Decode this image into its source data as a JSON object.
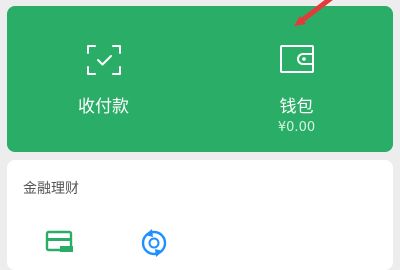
{
  "colors": {
    "card_green": "#2aae67",
    "annotation_red": "#e23b3b",
    "fin_green": "#2aae67",
    "fin_blue": "#1e90ff"
  },
  "top_card": {
    "pay": {
      "label": "收付款",
      "icon": "scan-qr-icon"
    },
    "wallet": {
      "label": "钱包",
      "balance": "¥0.00",
      "icon": "wallet-icon"
    }
  },
  "finance": {
    "title": "金融理财",
    "items": [
      {
        "icon": "card-icon"
      },
      {
        "icon": "refresh-coin-icon"
      }
    ]
  }
}
